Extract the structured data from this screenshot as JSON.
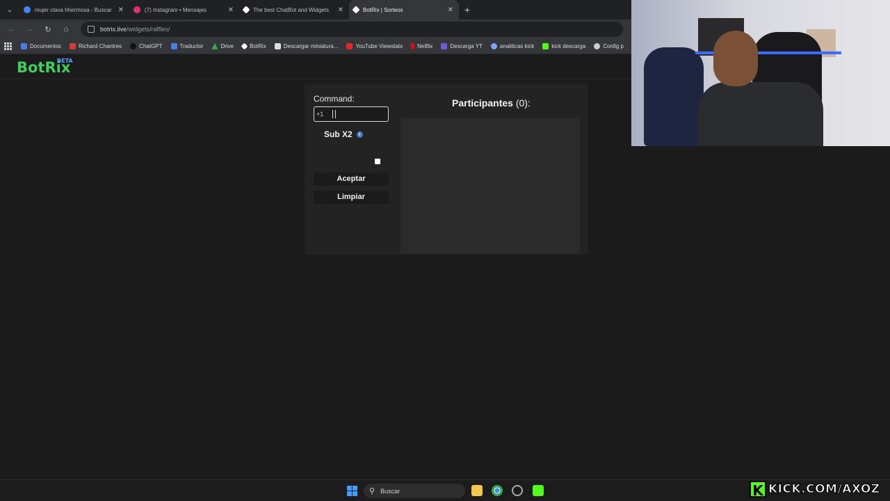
{
  "browser": {
    "tabs": [
      {
        "title": "mujer clava hhermosa - Buscar",
        "icon_color": "#4285f4"
      },
      {
        "title": "(7) Instagram • Mensajes",
        "icon_color": "#e1306c"
      },
      {
        "title": "The best ChatBot and Widgets",
        "icon_color": "#ffffff"
      },
      {
        "title": "BotRix | Sorteos",
        "icon_color": "#ffffff"
      }
    ],
    "active_tab": 3,
    "url_domain": "botrix.live",
    "url_path": "/widgets/raffles/",
    "bookmarks": [
      {
        "label": "Documentos",
        "color": "#4a7de1"
      },
      {
        "label": "Richard Chantres",
        "color": "#d23b3b"
      },
      {
        "label": "ChatGPT",
        "color": "#1a1a1a"
      },
      {
        "label": "Traductor",
        "color": "#4a7de1"
      },
      {
        "label": "Drive",
        "color": "#2bb34a"
      },
      {
        "label": "BotRix",
        "color": "#ffffff"
      },
      {
        "label": "Descargar miniatura...",
        "color": "#dddddd"
      },
      {
        "label": "YouTube Viewstats",
        "color": "#e02a2a"
      },
      {
        "label": "Netflix",
        "color": "#e50914"
      },
      {
        "label": "Descarga YT",
        "color": "#6b5bd6"
      },
      {
        "label": "analiticas kick",
        "color": "#7aa6ff"
      },
      {
        "label": "kick descarga",
        "color": "#53fc18"
      },
      {
        "label": "Config p",
        "color": "#cccccc"
      }
    ]
  },
  "app": {
    "brand": "BotRix",
    "badge": "BETA",
    "command_label": "Command:",
    "command_value": "+1",
    "sub_label": "Sub X2",
    "sub_checked": false,
    "accept_label": "Aceptar",
    "clear_label": "Limpiar",
    "participants_label": "Participantes",
    "participants_count": "(0):",
    "brand_color": "#3ecf5c"
  },
  "taskbar": {
    "search_placeholder": "Buscar"
  },
  "overlay": {
    "kick_handle": "KICK.COM/AXOZ"
  }
}
